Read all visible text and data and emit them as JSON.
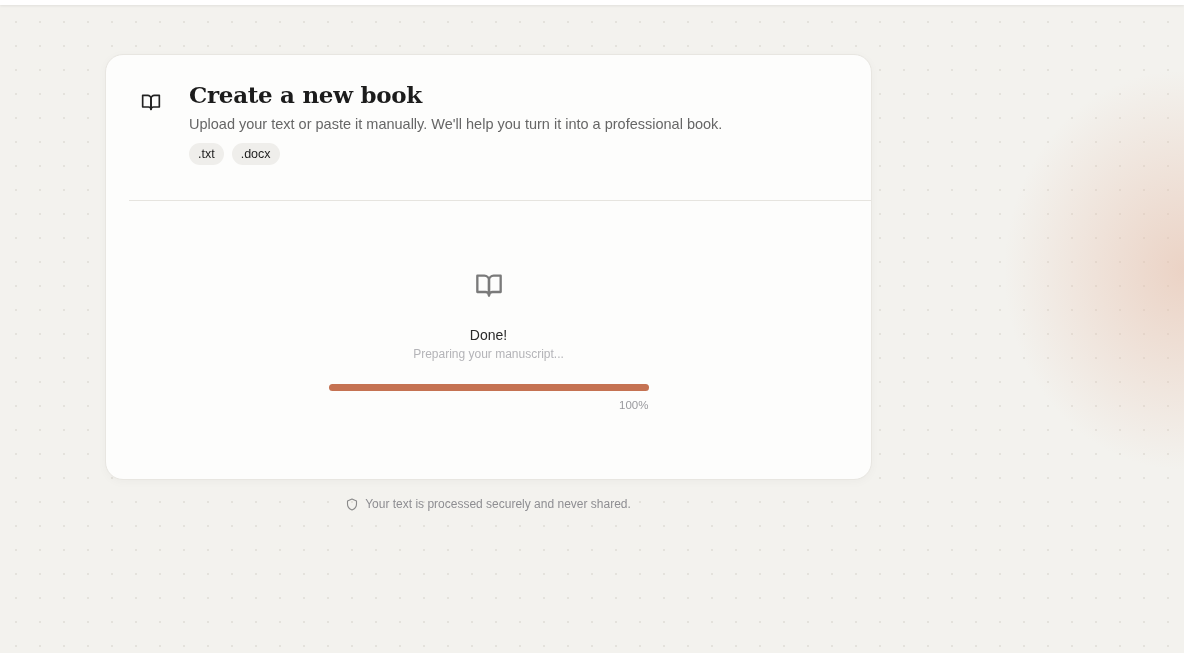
{
  "header": {
    "title": "Create a new book",
    "subtitle": "Upload your text or paste it manually. We'll help you turn it into a professional book.",
    "formats": [
      ".txt",
      ".docx"
    ]
  },
  "status": {
    "title": "Done!",
    "message": "Preparing your manuscript...",
    "progress": {
      "level": 1,
      "reading": "100%"
    }
  },
  "footer_note": "Your text is processed securely and never shared."
}
